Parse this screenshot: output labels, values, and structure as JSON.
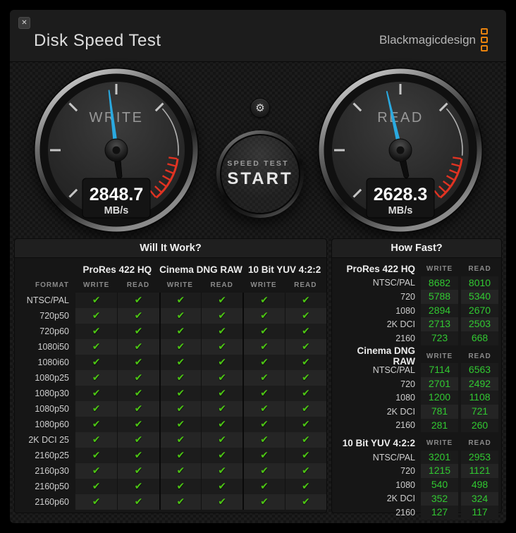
{
  "window": {
    "close_glyph": "✕"
  },
  "header": {
    "title": "Disk Speed Test",
    "logo_text": "Blackmagicdesign",
    "logo_accent_color": "#e8820e"
  },
  "controls": {
    "settings_icon_glyph": "⚙",
    "start_button": {
      "line1": "SPEED TEST",
      "line2": "START"
    }
  },
  "gauges": [
    {
      "label": "WRITE",
      "value": "2848.7",
      "unit": "MB/s",
      "needle_angle_deg": -7
    },
    {
      "label": "READ",
      "value": "2628.3",
      "unit": "MB/s",
      "needle_angle_deg": -13
    }
  ],
  "colors": {
    "needle_blue": "#2aa9e0",
    "redline_red": "#e03322",
    "check_green": "#4cc414",
    "number_green": "#31c931"
  },
  "will_it_work": {
    "title": "Will It Work?",
    "format_header": "FORMAT",
    "check_glyph": "✔",
    "codec_groups": [
      "ProRes 422 HQ",
      "Cinema DNG RAW",
      "10 Bit YUV 4:2:2"
    ],
    "sub_headers": [
      "WRITE",
      "READ"
    ],
    "rows": [
      {
        "label": "NTSC/PAL",
        "checks": [
          true,
          true,
          true,
          true,
          true,
          true
        ]
      },
      {
        "label": "720p50",
        "checks": [
          true,
          true,
          true,
          true,
          true,
          true
        ]
      },
      {
        "label": "720p60",
        "checks": [
          true,
          true,
          true,
          true,
          true,
          true
        ]
      },
      {
        "label": "1080i50",
        "checks": [
          true,
          true,
          true,
          true,
          true,
          true
        ]
      },
      {
        "label": "1080i60",
        "checks": [
          true,
          true,
          true,
          true,
          true,
          true
        ]
      },
      {
        "label": "1080p25",
        "checks": [
          true,
          true,
          true,
          true,
          true,
          true
        ]
      },
      {
        "label": "1080p30",
        "checks": [
          true,
          true,
          true,
          true,
          true,
          true
        ]
      },
      {
        "label": "1080p50",
        "checks": [
          true,
          true,
          true,
          true,
          true,
          true
        ]
      },
      {
        "label": "1080p60",
        "checks": [
          true,
          true,
          true,
          true,
          true,
          true
        ]
      },
      {
        "label": "2K DCI 25",
        "checks": [
          true,
          true,
          true,
          true,
          true,
          true
        ]
      },
      {
        "label": "2160p25",
        "checks": [
          true,
          true,
          true,
          true,
          true,
          true
        ]
      },
      {
        "label": "2160p30",
        "checks": [
          true,
          true,
          true,
          true,
          true,
          true
        ]
      },
      {
        "label": "2160p50",
        "checks": [
          true,
          true,
          true,
          true,
          true,
          true
        ]
      },
      {
        "label": "2160p60",
        "checks": [
          true,
          true,
          true,
          true,
          true,
          true
        ]
      }
    ]
  },
  "how_fast": {
    "title": "How Fast?",
    "sub_headers": [
      "WRITE",
      "READ"
    ],
    "groups": [
      {
        "codec": "ProRes 422 HQ",
        "rows": [
          {
            "label": "NTSC/PAL",
            "write": "8682",
            "read": "8010"
          },
          {
            "label": "720",
            "write": "5788",
            "read": "5340"
          },
          {
            "label": "1080",
            "write": "2894",
            "read": "2670"
          },
          {
            "label": "2K DCI",
            "write": "2713",
            "read": "2503"
          },
          {
            "label": "2160",
            "write": "723",
            "read": "668"
          }
        ]
      },
      {
        "codec": "Cinema DNG RAW",
        "rows": [
          {
            "label": "NTSC/PAL",
            "write": "7114",
            "read": "6563"
          },
          {
            "label": "720",
            "write": "2701",
            "read": "2492"
          },
          {
            "label": "1080",
            "write": "1200",
            "read": "1108"
          },
          {
            "label": "2K DCI",
            "write": "781",
            "read": "721"
          },
          {
            "label": "2160",
            "write": "281",
            "read": "260"
          }
        ]
      },
      {
        "codec": "10 Bit YUV 4:2:2",
        "rows": [
          {
            "label": "NTSC/PAL",
            "write": "3201",
            "read": "2953"
          },
          {
            "label": "720",
            "write": "1215",
            "read": "1121"
          },
          {
            "label": "1080",
            "write": "540",
            "read": "498"
          },
          {
            "label": "2K DCI",
            "write": "352",
            "read": "324"
          },
          {
            "label": "2160",
            "write": "127",
            "read": "117"
          }
        ]
      }
    ]
  }
}
